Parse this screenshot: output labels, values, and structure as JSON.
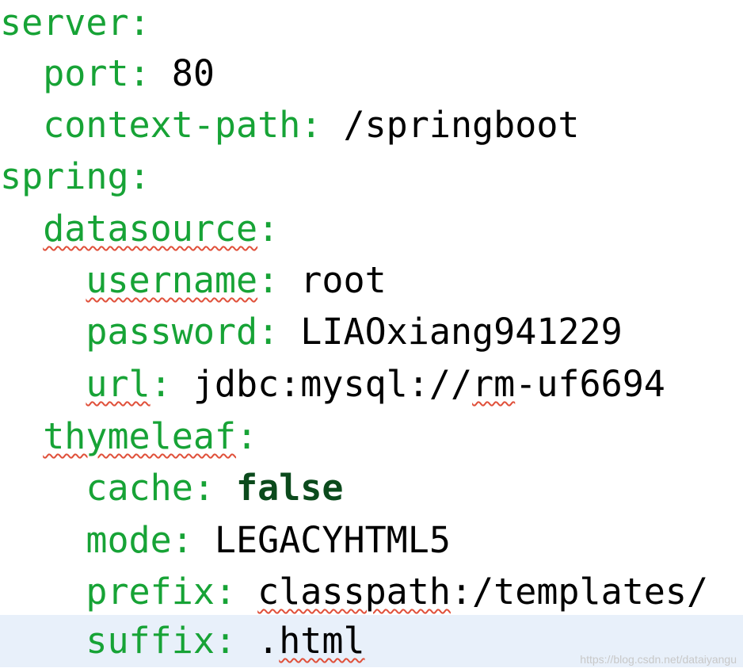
{
  "editor": {
    "lines": [
      {
        "key": "server",
        "colon": ":",
        "value": ""
      },
      {
        "key": "port",
        "colon": ":",
        "value": " 80"
      },
      {
        "key": "context-path",
        "colon": ":",
        "value": " /springboot"
      },
      {
        "key": "spring",
        "colon": ":",
        "value": ""
      },
      {
        "key": "datasource",
        "colon": ":",
        "value": ""
      },
      {
        "key": "username",
        "colon": ":",
        "value": " root"
      },
      {
        "key": "password",
        "colon": ":",
        "value": " LIAOxiang941229"
      },
      {
        "key": "url",
        "colon": ":",
        "value_pre": " jdbc:mysql://",
        "value_sq": "rm",
        "value_post": "-uf6694"
      },
      {
        "key": "thymeleaf",
        "colon": ":",
        "value": ""
      },
      {
        "key": "cache",
        "colon": ":",
        "value_sp": " ",
        "value_kw": "false"
      },
      {
        "key": "mode",
        "colon": ":",
        "value": " LEGACYHTML5"
      },
      {
        "key": "prefix",
        "colon": ":",
        "value_sp": " ",
        "value_sq": "classpath",
        "value_post": ":/templates/"
      },
      {
        "key": "suffix",
        "colon": ":",
        "value_pre": " .",
        "value_sq": "html"
      }
    ],
    "indents": {
      "level0": "",
      "level1": "  ",
      "level2": "    "
    }
  },
  "watermark": "https://blog.csdn.net/dataiyangu",
  "colors": {
    "key": "#17a336",
    "keyword": "#0b4a1c",
    "value": "#000000",
    "current_line": "#e8f0fa",
    "squiggle": "#e0503a"
  }
}
